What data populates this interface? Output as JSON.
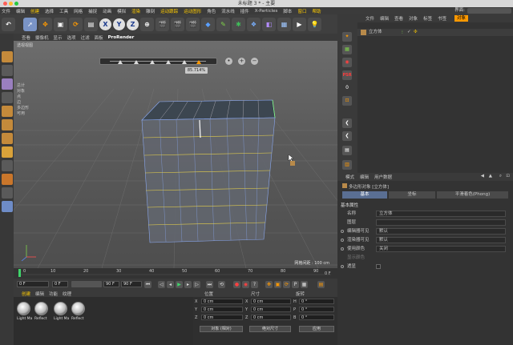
{
  "window": {
    "title": "未标题 3 * - 主要"
  },
  "menubar": {
    "items": [
      "文件",
      "编辑",
      "创建",
      "选择",
      "工具",
      "网格",
      "捕捉",
      "动画",
      "模拟",
      "渲染",
      "雕刻",
      "运动跟踪",
      "运动图形",
      "角色",
      "流水线",
      "插件",
      "X-Particles",
      "脚本",
      "窗口",
      "帮助"
    ],
    "layout_label": "界面:"
  },
  "toolbar": {
    "axis_x": "X",
    "axis_y": "Y",
    "axis_z": "Z"
  },
  "viewport": {
    "menu": [
      "查看",
      "摄像机",
      "显示",
      "选项",
      "过滤",
      "面板",
      "ProRender"
    ],
    "view_name": "透视视图",
    "selection_pct": "85.714%",
    "stats": [
      "总计",
      "对象",
      "点",
      "边",
      "多边形",
      "可用"
    ],
    "grid_spacing": "网格间距 : 100 cm"
  },
  "timeline": {
    "ticks": [
      "0",
      "10",
      "20",
      "30",
      "40",
      "50",
      "60",
      "70",
      "80",
      "90"
    ],
    "end_frame": "0 F",
    "start_field": "0 F",
    "cur_field": "0 F",
    "max_field": "90 F",
    "end_field": "90 F"
  },
  "materials": {
    "menu": [
      "创建",
      "编辑",
      "功能",
      "纹理"
    ],
    "items": [
      {
        "label": "Light Ma"
      },
      {
        "label": "Reflect"
      },
      {
        "label": "Light Ma"
      },
      {
        "label": "Reflect"
      }
    ]
  },
  "coordinates": {
    "col_pos": "位置",
    "col_size": "尺寸",
    "col_rot": "旋转",
    "rows": [
      {
        "axis": "X",
        "pos": "0 cm",
        "size": "0 cm",
        "rot_axis": "H",
        "rot": "0 °"
      },
      {
        "axis": "Y",
        "pos": "0 cm",
        "size": "0 cm",
        "rot_axis": "P",
        "rot": "0 °"
      },
      {
        "axis": "Z",
        "pos": "0 cm",
        "size": "0 cm",
        "rot_axis": "B",
        "rot": "0 °"
      }
    ],
    "mode_select": "对象 (相对)",
    "size_select": "绝对尺寸",
    "apply_button": "应用"
  },
  "objects": {
    "menu": [
      "文件",
      "编辑",
      "查看",
      "对象",
      "标签",
      "书签"
    ],
    "active_tab": "对象",
    "rows": [
      {
        "name": "立方体"
      }
    ]
  },
  "attributes": {
    "menu": [
      "模式",
      "编辑",
      "用户数据"
    ],
    "object_label": "多边形对象 [立方体]",
    "tabs": [
      "基本",
      "坐标",
      "平滑着色(Phong)"
    ],
    "section": "基本属性",
    "fields": [
      {
        "label": "名称",
        "value": "立方体"
      },
      {
        "label": "图层",
        "value": ""
      },
      {
        "label": "编辑器可见",
        "value": "默认"
      },
      {
        "label": "渲染器可见",
        "value": "默认"
      },
      {
        "label": "使用颜色",
        "value": "关闭"
      },
      {
        "label": "显示颜色",
        "value": ""
      },
      {
        "label": "透显",
        "value": ""
      }
    ]
  },
  "colors": {
    "accent": "#ff9900",
    "selection_yellow": "#e8d24a",
    "wire_blue": "#8fb0ff"
  }
}
